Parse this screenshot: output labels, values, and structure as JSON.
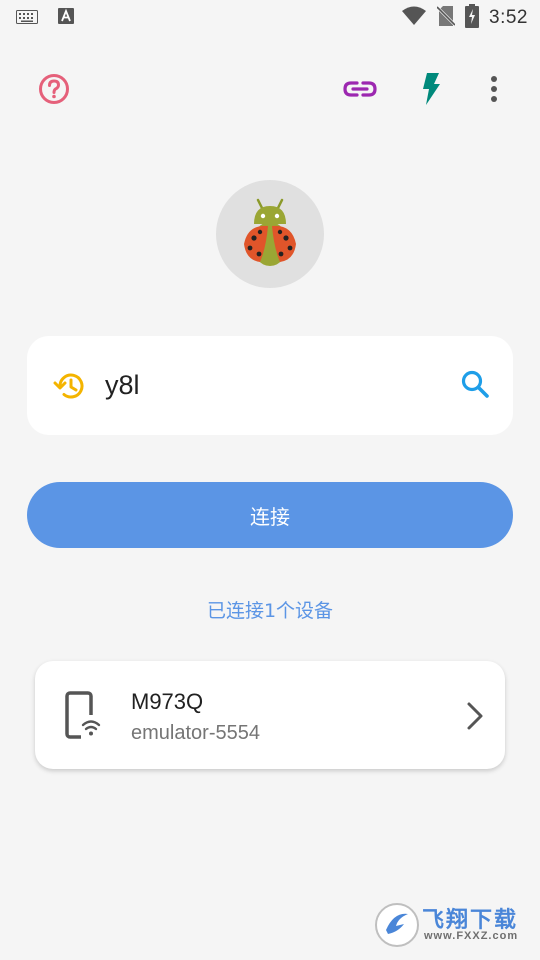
{
  "status_bar": {
    "time": "3:52",
    "icons": [
      "keyboard-icon",
      "a-notification-icon",
      "wifi-icon",
      "no-sim-icon",
      "battery-charging-icon"
    ]
  },
  "toolbar": {
    "help_icon": "help-circle-icon",
    "link_icon": "link-icon",
    "flash_icon": "lightning-icon",
    "menu_icon": "more-vert-icon"
  },
  "logo": {
    "icon": "ladybug-android-icon"
  },
  "search": {
    "value": "y8l",
    "placeholder": "",
    "history_icon": "history-icon",
    "search_icon": "search-icon"
  },
  "connect": {
    "label": "连接"
  },
  "status": {
    "connected_text": "已连接1个设备"
  },
  "devices": [
    {
      "name": "M973Q",
      "serial": "emulator-5554",
      "icon": "phone-wifi-icon"
    }
  ],
  "watermark": {
    "text": "飞翔下载",
    "url": "www.FXXZ.com"
  },
  "colors": {
    "accent": "#5b95e5",
    "help": "#e5607a",
    "link": "#9c27b0",
    "flash": "#00897b",
    "history": "#f4b400",
    "search": "#1e9ee8"
  }
}
